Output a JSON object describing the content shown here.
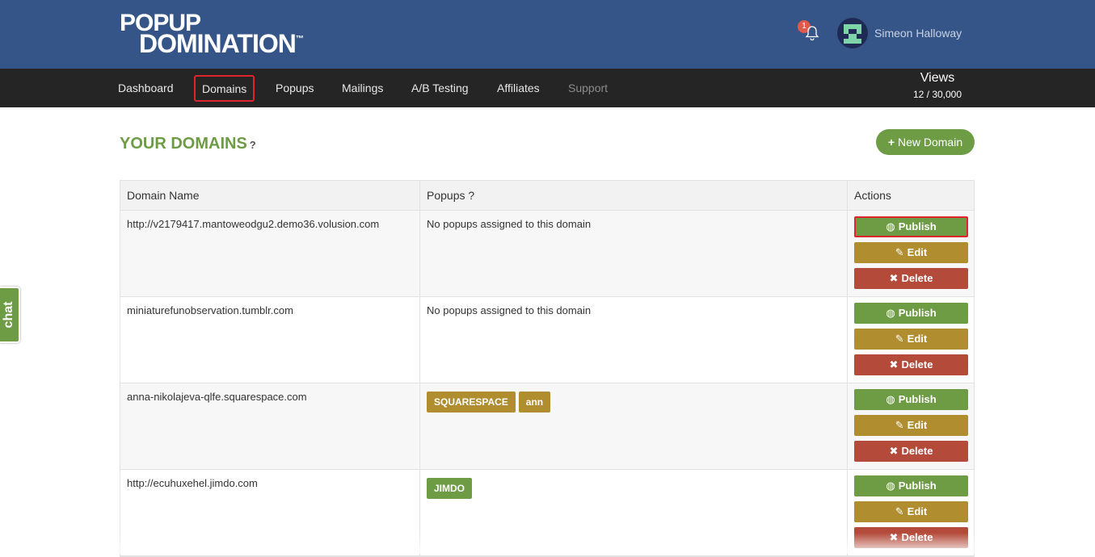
{
  "header": {
    "logo_line1": "POPUP",
    "logo_line2": "DOMINATION",
    "logo_tm": "™",
    "notification_count": "1",
    "username": "Simeon Halloway"
  },
  "nav": {
    "items": [
      "Dashboard",
      "Domains",
      "Popups",
      "Mailings",
      "A/B Testing",
      "Affiliates",
      "Support"
    ],
    "active": "Domains"
  },
  "views": {
    "label": "Views",
    "count": "12 / 30,000"
  },
  "page": {
    "title": "YOUR DOMAINS",
    "help": "?",
    "new_domain_label": "New Domain",
    "new_domain_icon": "+"
  },
  "table": {
    "headers": [
      "Domain Name",
      "Popups ?",
      "Actions"
    ],
    "rows": [
      {
        "domain": "http://v2179417.mantoweodgu2.demo36.volusion.com",
        "popups_text": "No popups assigned to this domain",
        "tags": []
      },
      {
        "domain": "miniaturefunobservation.tumblr.com",
        "popups_text": "No popups assigned to this domain",
        "tags": []
      },
      {
        "domain": "anna-nikolajeva-qlfe.squarespace.com",
        "popups_text": "",
        "tags": [
          "SQUARESPACE",
          "ann"
        ]
      },
      {
        "domain": "http://ecuhuxehel.jimdo.com",
        "popups_text": "",
        "tags": [
          "JIMDO"
        ]
      }
    ],
    "actions": {
      "publish": "Publish",
      "edit": "Edit",
      "delete": "Delete"
    }
  },
  "chat": {
    "label": "chat"
  },
  "colors": {
    "header": "#355487",
    "nav": "#252525",
    "green": "#6d9c45",
    "gold": "#b08d2f",
    "red": "#b34a3a",
    "highlight": "#e0242c"
  },
  "icons": {
    "publish": "globe-icon",
    "edit": "edit-icon",
    "delete": "close-icon",
    "bell": "bell-icon"
  }
}
